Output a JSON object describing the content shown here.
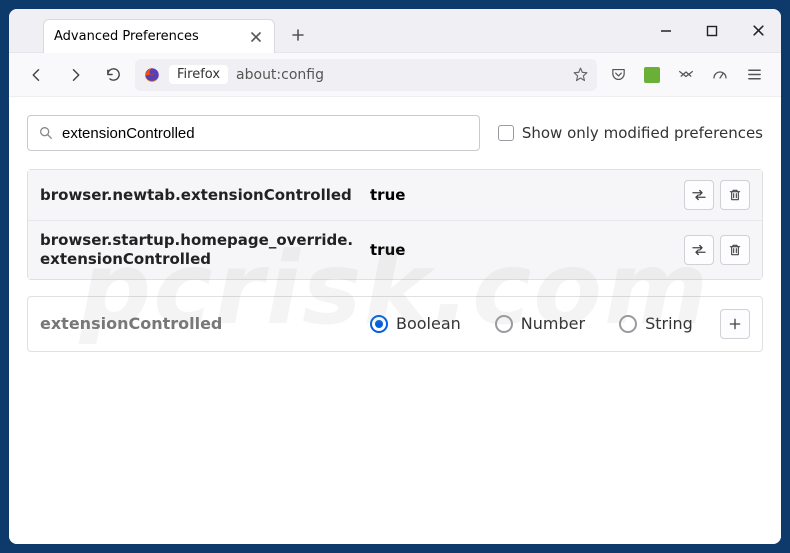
{
  "window": {
    "tab_title": "Advanced Preferences",
    "address_label": "Firefox",
    "url": "about:config"
  },
  "page": {
    "search_value": "extensionControlled",
    "modified_only_label": "Show only modified preferences",
    "modified_only_checked": false
  },
  "results": [
    {
      "name": "browser.newtab.extensionControlled",
      "value": "true"
    },
    {
      "name": "browser.startup.homepage_override.extensionControlled",
      "value": "true"
    }
  ],
  "new_pref": {
    "name": "extensionControlled",
    "types": [
      "Boolean",
      "Number",
      "String"
    ],
    "selected": "Boolean"
  },
  "watermark": "pcrisk.com"
}
